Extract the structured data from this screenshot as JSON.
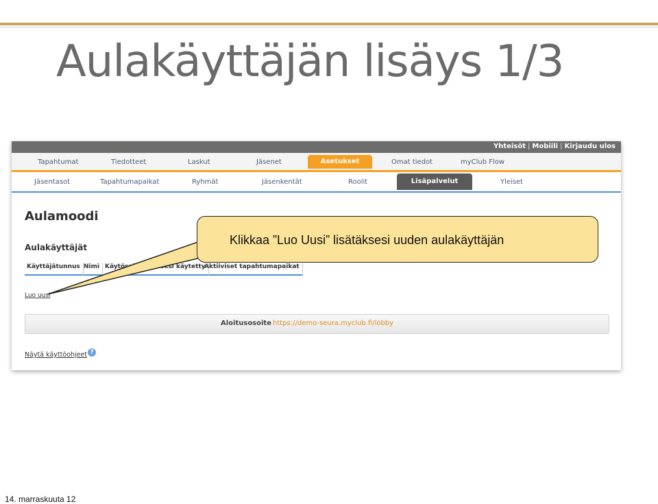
{
  "slide": {
    "title": "Aulakäyttäjän lisäys 1/3",
    "footer": "14. marraskuuta 12",
    "callout": "Klikkaa ”Luo Uusi” lisätäksesi uuden aulakäyttäjän"
  },
  "topbar": {
    "links": [
      "Yhteisöt",
      "Mobiili",
      "Kirjaudu ulos"
    ]
  },
  "nav": {
    "items": [
      "Tapahtumat",
      "Tiedotteet",
      "Laskut",
      "Jäsenet",
      "Asetukset",
      "Omat tiedot",
      "myClub Flow"
    ],
    "active": "Asetukset"
  },
  "subnav": {
    "items": [
      "Jäsentasot",
      "Tapahtumapaikat",
      "Ryhmät",
      "Jäsenkentät",
      "Roolit",
      "Lisäpalvelut",
      "Yleiset"
    ],
    "active": "Lisäpalvelut"
  },
  "page": {
    "heading": "Aulamoodi",
    "section": "Aulakäyttäjät",
    "table_headers": [
      "Käyttäjätunnus",
      "Nimi",
      "Käytössä",
      "Viimeksi käytetty",
      "Aktiiviset tapahtumapaikat"
    ],
    "create_link": "Luo uusi",
    "start_url_label": "Aloitusosoite",
    "start_url": "https://demo-seura.myclub.fi/lobby",
    "help_link": "Näytä käyttöohjeet"
  },
  "colors": {
    "accent_orange": "#f5a023",
    "callout_fill": "#fbe39a",
    "title_gray": "#6a6a6a",
    "link_blue": "#4a90d9"
  },
  "icons": {
    "help": "question-mark-icon"
  }
}
